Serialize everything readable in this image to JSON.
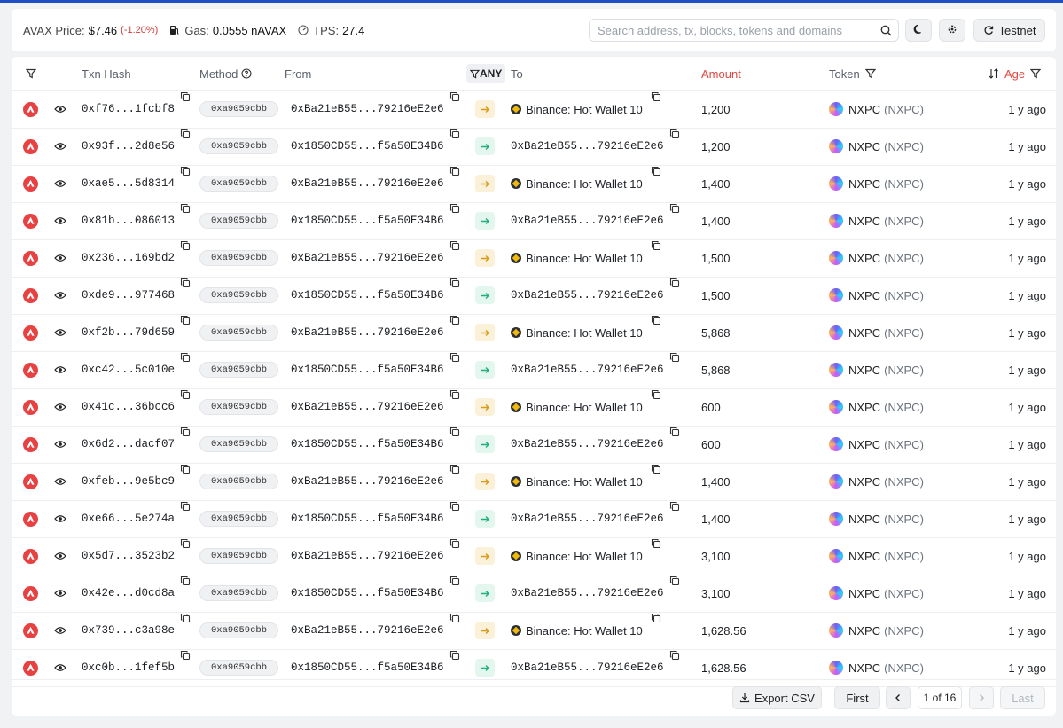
{
  "header": {
    "avax_label": "AVAX Price:",
    "avax_price": "$7.46",
    "avax_change": "(-1.20%)",
    "gas_label": "Gas:",
    "gas_value": "0.0555 nAVAX",
    "tps_label": "TPS:",
    "tps_value": "27.4",
    "search_placeholder": "Search address, tx, blocks, tokens and domains",
    "testnet_label": "Testnet"
  },
  "table": {
    "columns": {
      "txn_hash": "Txn Hash",
      "method": "Method",
      "from": "From",
      "direction": "ANY",
      "to": "To",
      "amount": "Amount",
      "token": "Token",
      "age": "Age"
    },
    "rows": [
      {
        "hash": "0xf76...1fcbf8",
        "method": "0xa9059cbb",
        "from": "0xBa21eB55...79216eE2e6",
        "dir": "out",
        "to": "Binance: Hot Wallet 10",
        "to_named": true,
        "amount": "1,200",
        "token": "NXPC",
        "token_sym": "(NXPC)",
        "age": "1 y ago"
      },
      {
        "hash": "0x93f...2d8e56",
        "method": "0xa9059cbb",
        "from": "0x1850CD55...f5a50E34B6",
        "dir": "in",
        "to": "0xBa21eB55...79216eE2e6",
        "to_named": false,
        "amount": "1,200",
        "token": "NXPC",
        "token_sym": "(NXPC)",
        "age": "1 y ago"
      },
      {
        "hash": "0xae5...5d8314",
        "method": "0xa9059cbb",
        "from": "0xBa21eB55...79216eE2e6",
        "dir": "out",
        "to": "Binance: Hot Wallet 10",
        "to_named": true,
        "amount": "1,400",
        "token": "NXPC",
        "token_sym": "(NXPC)",
        "age": "1 y ago"
      },
      {
        "hash": "0x81b...086013",
        "method": "0xa9059cbb",
        "from": "0x1850CD55...f5a50E34B6",
        "dir": "in",
        "to": "0xBa21eB55...79216eE2e6",
        "to_named": false,
        "amount": "1,400",
        "token": "NXPC",
        "token_sym": "(NXPC)",
        "age": "1 y ago"
      },
      {
        "hash": "0x236...169bd2",
        "method": "0xa9059cbb",
        "from": "0xBa21eB55...79216eE2e6",
        "dir": "out",
        "to": "Binance: Hot Wallet 10",
        "to_named": true,
        "amount": "1,500",
        "token": "NXPC",
        "token_sym": "(NXPC)",
        "age": "1 y ago"
      },
      {
        "hash": "0xde9...977468",
        "method": "0xa9059cbb",
        "from": "0x1850CD55...f5a50E34B6",
        "dir": "in",
        "to": "0xBa21eB55...79216eE2e6",
        "to_named": false,
        "amount": "1,500",
        "token": "NXPC",
        "token_sym": "(NXPC)",
        "age": "1 y ago"
      },
      {
        "hash": "0xf2b...79d659",
        "method": "0xa9059cbb",
        "from": "0xBa21eB55...79216eE2e6",
        "dir": "out",
        "to": "Binance: Hot Wallet 10",
        "to_named": true,
        "amount": "5,868",
        "token": "NXPC",
        "token_sym": "(NXPC)",
        "age": "1 y ago"
      },
      {
        "hash": "0xc42...5c010e",
        "method": "0xa9059cbb",
        "from": "0x1850CD55...f5a50E34B6",
        "dir": "in",
        "to": "0xBa21eB55...79216eE2e6",
        "to_named": false,
        "amount": "5,868",
        "token": "NXPC",
        "token_sym": "(NXPC)",
        "age": "1 y ago"
      },
      {
        "hash": "0x41c...36bcc6",
        "method": "0xa9059cbb",
        "from": "0xBa21eB55...79216eE2e6",
        "dir": "out",
        "to": "Binance: Hot Wallet 10",
        "to_named": true,
        "amount": "600",
        "token": "NXPC",
        "token_sym": "(NXPC)",
        "age": "1 y ago"
      },
      {
        "hash": "0x6d2...dacf07",
        "method": "0xa9059cbb",
        "from": "0x1850CD55...f5a50E34B6",
        "dir": "in",
        "to": "0xBa21eB55...79216eE2e6",
        "to_named": false,
        "amount": "600",
        "token": "NXPC",
        "token_sym": "(NXPC)",
        "age": "1 y ago"
      },
      {
        "hash": "0xfeb...9e5bc9",
        "method": "0xa9059cbb",
        "from": "0xBa21eB55...79216eE2e6",
        "dir": "out",
        "to": "Binance: Hot Wallet 10",
        "to_named": true,
        "amount": "1,400",
        "token": "NXPC",
        "token_sym": "(NXPC)",
        "age": "1 y ago"
      },
      {
        "hash": "0xe66...5e274a",
        "method": "0xa9059cbb",
        "from": "0x1850CD55...f5a50E34B6",
        "dir": "in",
        "to": "0xBa21eB55...79216eE2e6",
        "to_named": false,
        "amount": "1,400",
        "token": "NXPC",
        "token_sym": "(NXPC)",
        "age": "1 y ago"
      },
      {
        "hash": "0x5d7...3523b2",
        "method": "0xa9059cbb",
        "from": "0xBa21eB55...79216eE2e6",
        "dir": "out",
        "to": "Binance: Hot Wallet 10",
        "to_named": true,
        "amount": "3,100",
        "token": "NXPC",
        "token_sym": "(NXPC)",
        "age": "1 y ago"
      },
      {
        "hash": "0x42e...d0cd8a",
        "method": "0xa9059cbb",
        "from": "0x1850CD55...f5a50E34B6",
        "dir": "in",
        "to": "0xBa21eB55...79216eE2e6",
        "to_named": false,
        "amount": "3,100",
        "token": "NXPC",
        "token_sym": "(NXPC)",
        "age": "1 y ago"
      },
      {
        "hash": "0x739...c3a98e",
        "method": "0xa9059cbb",
        "from": "0xBa21eB55...79216eE2e6",
        "dir": "out",
        "to": "Binance: Hot Wallet 10",
        "to_named": true,
        "amount": "1,628.56",
        "token": "NXPC",
        "token_sym": "(NXPC)",
        "age": "1 y ago"
      },
      {
        "hash": "0xc0b...1fef5b",
        "method": "0xa9059cbb",
        "from": "0x1850CD55...f5a50E34B6",
        "dir": "in",
        "to": "0xBa21eB55...79216eE2e6",
        "to_named": false,
        "amount": "1,628.56",
        "token": "NXPC",
        "token_sym": "(NXPC)",
        "age": "1 y ago"
      }
    ]
  },
  "footer": {
    "export_label": "Export CSV",
    "first_label": "First",
    "page_label": "1 of 16",
    "last_label": "Last"
  },
  "colors": {
    "accent_blue": "#1e4fc4",
    "negative": "#d23b3b",
    "amount_header": "#e4473f",
    "out_arrow": "#d79a19",
    "in_arrow": "#22b07a"
  },
  "icons": {
    "chain": "avalanche-icon",
    "row_view": "eye-icon",
    "copy": "copy-icon",
    "binance": "binance-icon",
    "token": "nxpc-token-icon"
  }
}
